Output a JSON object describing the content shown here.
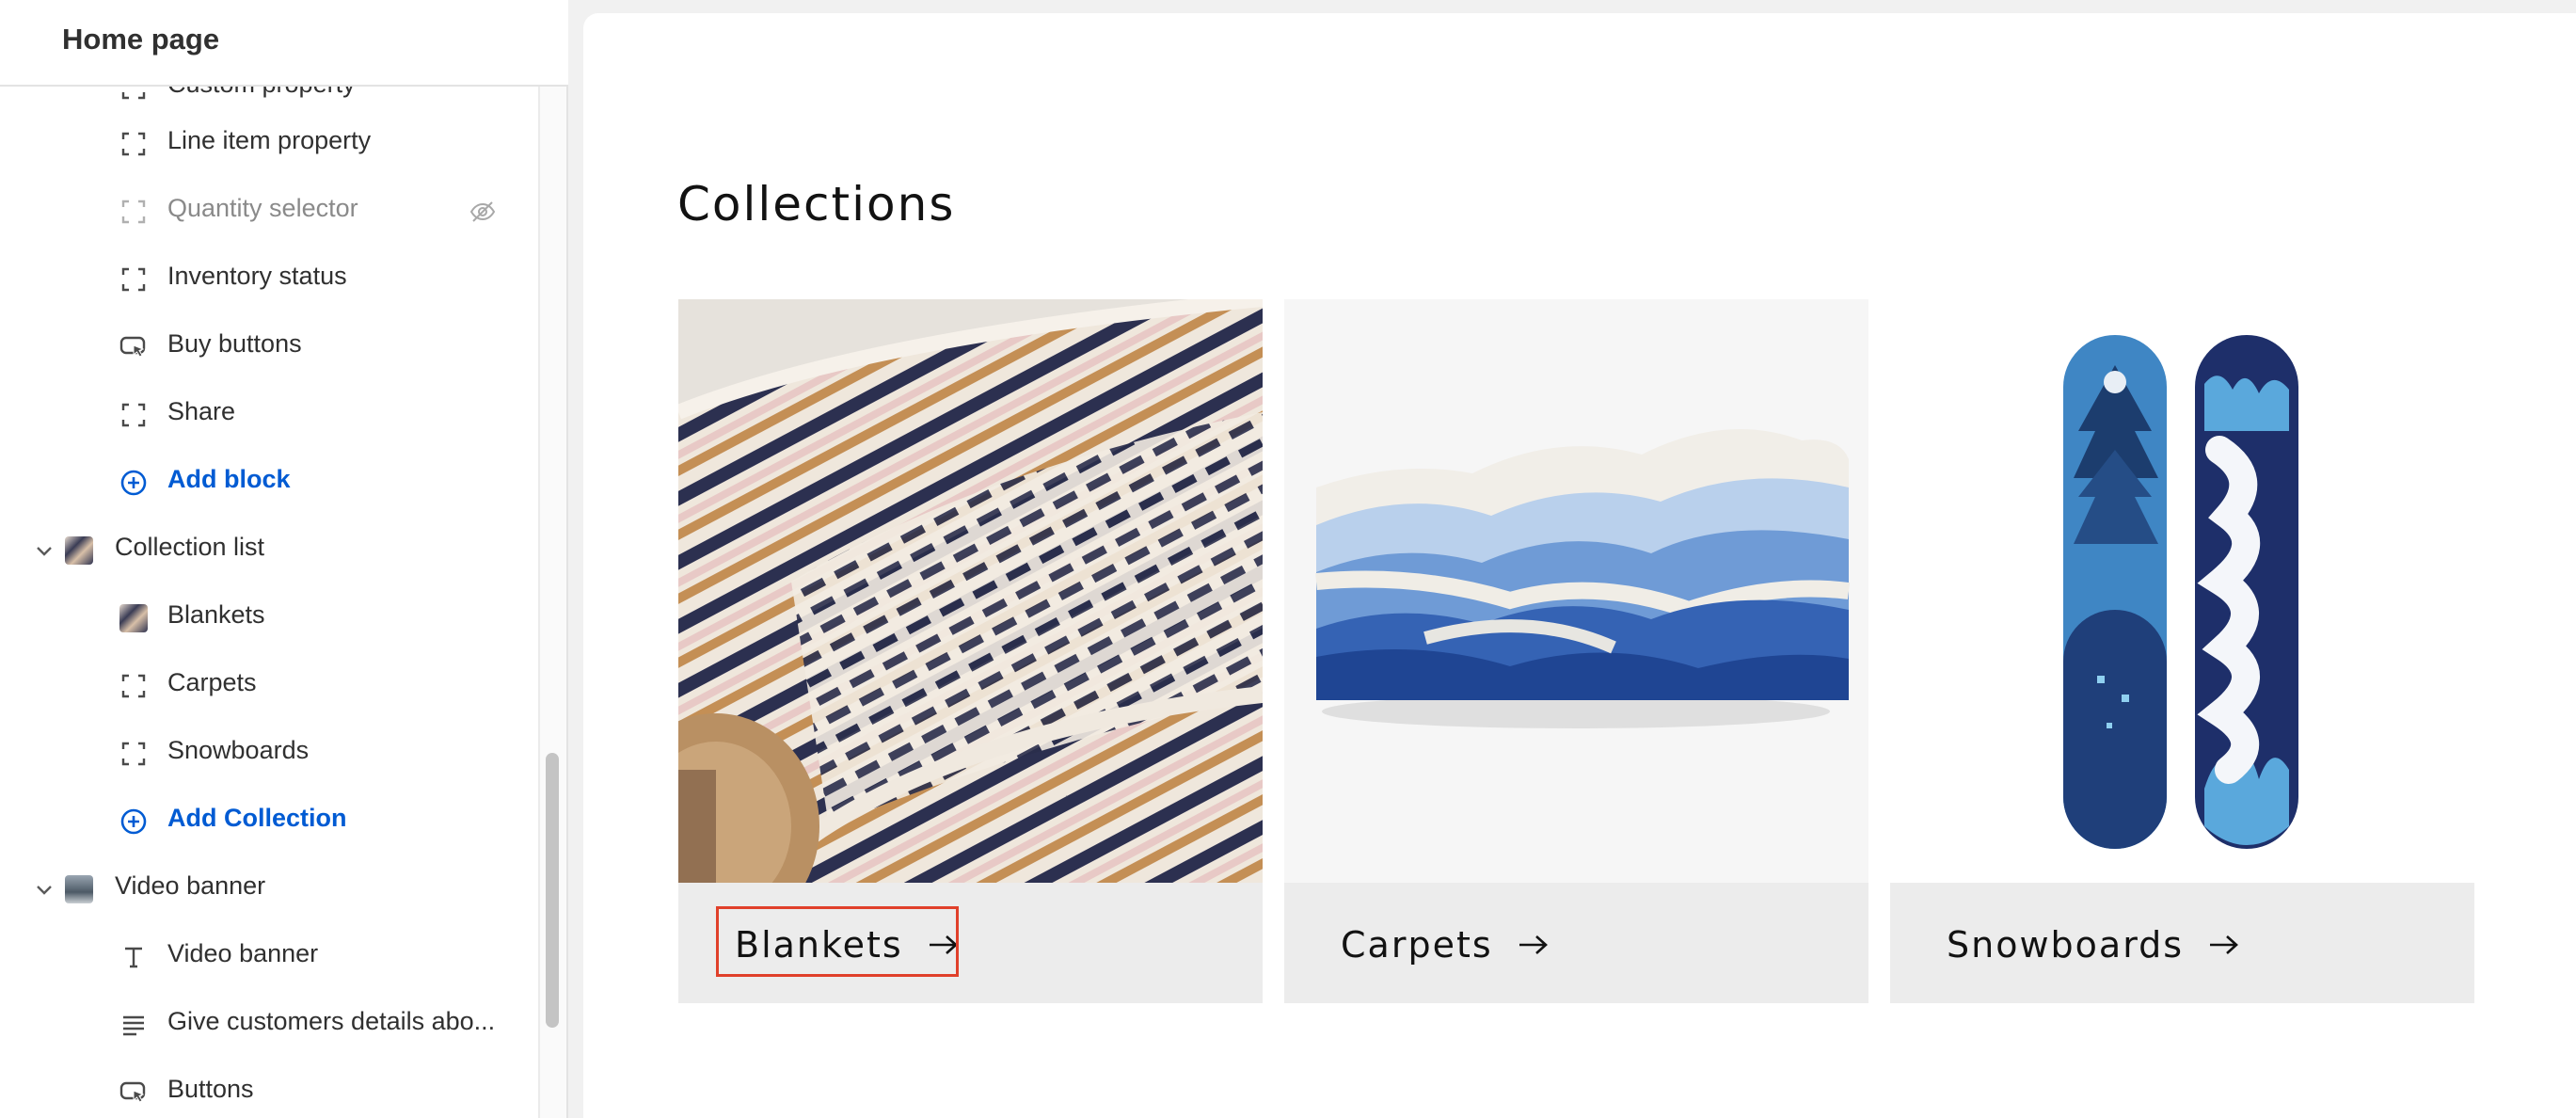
{
  "sidebar": {
    "title": "Home page",
    "partial_top_item": "Custom property",
    "items": [
      {
        "label": "Line item property",
        "icon": "dashed-square-icon",
        "type": "child"
      },
      {
        "label": "Quantity selector",
        "icon": "dashed-square-icon",
        "type": "child",
        "hidden": true
      },
      {
        "label": "Inventory status",
        "icon": "dashed-square-icon",
        "type": "child"
      },
      {
        "label": "Buy buttons",
        "icon": "cursor-button-icon",
        "type": "child"
      },
      {
        "label": "Share",
        "icon": "dashed-square-icon",
        "type": "child"
      },
      {
        "label": "Add block",
        "icon": "plus-circle-icon",
        "type": "add"
      },
      {
        "label": "Collection list",
        "icon": "collection-thumbnail",
        "type": "parent"
      },
      {
        "label": "Blankets",
        "icon": "blanket-thumbnail",
        "type": "child"
      },
      {
        "label": "Carpets",
        "icon": "dashed-square-icon",
        "type": "child"
      },
      {
        "label": "Snowboards",
        "icon": "dashed-square-icon",
        "type": "child"
      },
      {
        "label": "Add Collection",
        "icon": "plus-circle-icon",
        "type": "add"
      },
      {
        "label": "Video banner",
        "icon": "video-thumbnail",
        "type": "parent"
      },
      {
        "label": "Video banner",
        "icon": "text-icon",
        "type": "child"
      },
      {
        "label": "Give customers details abo...",
        "icon": "paragraph-icon",
        "type": "child"
      },
      {
        "label": "Buttons",
        "icon": "cursor-button-icon",
        "type": "child"
      }
    ],
    "hidden_icon": "eye-slash-icon"
  },
  "preview": {
    "heading": "Collections",
    "collections": [
      {
        "label": "Blankets",
        "image": "blanket-photo",
        "arrow": "arrow-right-icon",
        "selected": true
      },
      {
        "label": "Carpets",
        "image": "carpet-photo",
        "arrow": "arrow-right-icon",
        "selected": false
      },
      {
        "label": "Snowboards",
        "image": "snowboards-photo",
        "arrow": "arrow-right-icon",
        "selected": false
      }
    ]
  },
  "colors": {
    "accent_link": "#005bd3",
    "selection_outline": "#e0402a",
    "card_caption_bg": "#ececec"
  }
}
